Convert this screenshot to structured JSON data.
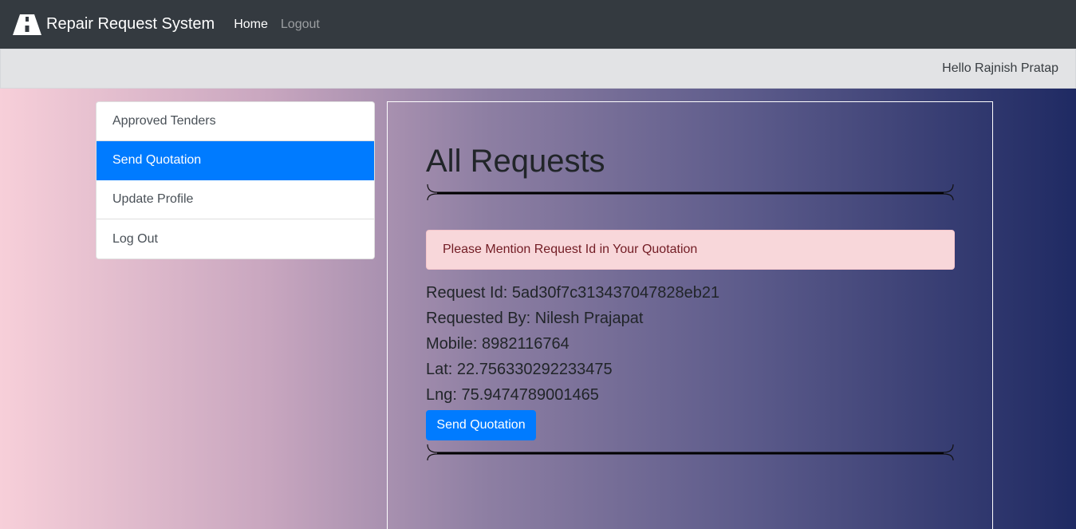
{
  "navbar": {
    "brand": "Repair Request System",
    "brand_icon": "road-icon",
    "links": [
      "Home",
      "Logout"
    ]
  },
  "greeting": "Hello Rajnish Pratap",
  "sidebar": {
    "items": [
      {
        "label": "Approved Tenders",
        "active": false
      },
      {
        "label": "Send Quotation",
        "active": true
      },
      {
        "label": "Update Profile",
        "active": false
      },
      {
        "label": "Log Out",
        "active": false
      }
    ]
  },
  "main": {
    "title": "All Requests",
    "alert": "Please Mention Request Id in Your Quotation",
    "request": {
      "id_line": "Request Id: 5ad30f7c313437047828eb21",
      "requested_by_line": "Requested By: Nilesh Prajapat",
      "mobile_line": "Mobile: 8982116764",
      "lat_line": "Lat: 22.756330292233475",
      "lng_line": "Lng: 75.9474789001465"
    },
    "button_label": "Send Quotation"
  },
  "colors": {
    "navbar": "#343a40",
    "primary": "#007bff",
    "alert_bg": "#f8d7da",
    "alert_text": "#721c24"
  }
}
